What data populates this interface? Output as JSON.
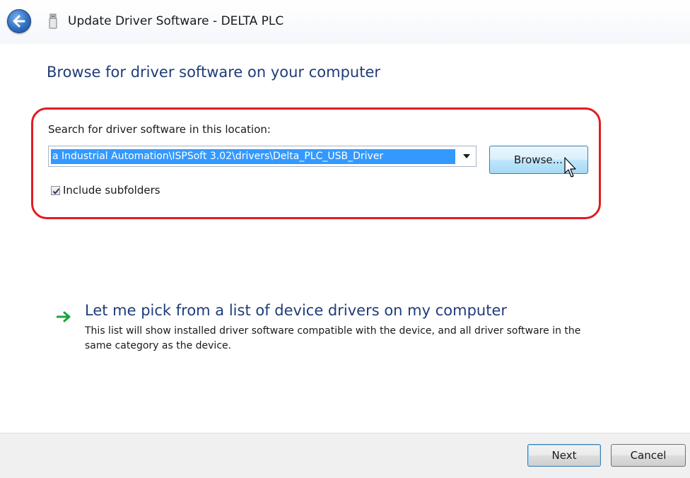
{
  "window": {
    "title": "Update Driver Software - DELTA PLC",
    "back_icon": "back-arrow-icon",
    "device_icon": "usb-device-icon"
  },
  "page": {
    "heading": "Browse for driver software on your computer"
  },
  "search": {
    "label": "Search for driver software in this location:",
    "path_value": "a Industrial Automation\\ISPSoft 3.02\\drivers\\Delta_PLC_USB_Driver",
    "browse_label": "Browse...",
    "include_subfolders_label": "Include subfolders",
    "include_subfolders_checked": true
  },
  "pick": {
    "icon": "green-arrow-icon",
    "title": "Let me pick from a list of device drivers on my computer",
    "description": "This list will show installed driver software compatible with the device, and all driver software in the same category as the device."
  },
  "footer": {
    "next_label": "Next",
    "cancel_label": "Cancel"
  },
  "colors": {
    "heading": "#1f3d7a",
    "highlight_ring": "#e01c24",
    "selection": "#3399ff",
    "arrow_green": "#1aa33c"
  }
}
